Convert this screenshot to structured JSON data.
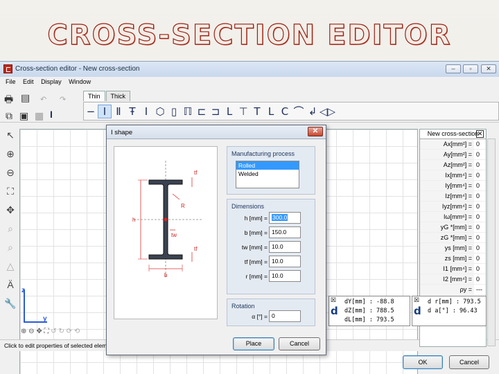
{
  "slide": {
    "title": "CROSS-SECTION EDITOR"
  },
  "window": {
    "title": "Cross-section editor - New cross-section",
    "controls": [
      "–",
      "▫",
      "✕"
    ]
  },
  "menu": [
    "File",
    "Edit",
    "Display",
    "Window"
  ],
  "tabs": [
    "Thin",
    "Thick"
  ],
  "status": "Click to edit properties of selected eleme",
  "axes": {
    "z": "z",
    "y": "y"
  },
  "properties": {
    "header": "New cross-section",
    "rows": [
      {
        "label": "Ax[mm²] =",
        "value": "0"
      },
      {
        "label": "Ay[mm²] =",
        "value": "0"
      },
      {
        "label": "Az[mm²] =",
        "value": "0"
      },
      {
        "label": "Ix[mm⁴] =",
        "value": "0"
      },
      {
        "label": "Iy[mm⁴] =",
        "value": "0"
      },
      {
        "label": "Iz[mm⁴] =",
        "value": "0"
      },
      {
        "label": "Iyz[mm⁴] =",
        "value": "0"
      },
      {
        "label": "Iω[mm⁶] =",
        "value": "0"
      },
      {
        "label": "yG *[mm] =",
        "value": "0"
      },
      {
        "label": "zG *[mm] =",
        "value": "0"
      },
      {
        "label": "ys [mm] =",
        "value": "0"
      },
      {
        "label": "zs [mm] =",
        "value": "0"
      },
      {
        "label": "I1 [mm⁴] =",
        "value": "0"
      },
      {
        "label": "I2 [mm⁴] =",
        "value": "0"
      }
    ],
    "partial_row": {
      "label": "ρy =",
      "value": "---"
    }
  },
  "info1": {
    "lines": [
      "dY[mm] : -88.8",
      "dZ[mm] : 788.5",
      "dL[mm] : 793.5"
    ]
  },
  "info2": {
    "lines": [
      "d r[mm] : 793.5",
      "d  a[°] : 96.43"
    ]
  },
  "footer": {
    "ok": "OK",
    "cancel": "Cancel"
  },
  "dialog": {
    "title": "I shape",
    "manufacturing": {
      "label": "Manufacturing process",
      "options": [
        "Rolled",
        "Welded"
      ],
      "selected": "Rolled"
    },
    "dimensions": {
      "label": "Dimensions",
      "fields": [
        {
          "label": "h [mm] =",
          "value": "300.0"
        },
        {
          "label": "b [mm] =",
          "value": "150.0"
        },
        {
          "label": "tw [mm] =",
          "value": "10.0"
        },
        {
          "label": "tf [mm] =",
          "value": "10.0"
        },
        {
          "label": "r [mm] =",
          "value": "10.0"
        }
      ]
    },
    "rotation": {
      "label": "Rotation",
      "field": {
        "label": "α [°] =",
        "value": "0"
      }
    },
    "preview_labels": {
      "tf_top": "tf",
      "r": "R",
      "h": "h",
      "tw": "tw",
      "tf_bottom": "tf",
      "b": "b"
    },
    "buttons": {
      "place": "Place",
      "cancel": "Cancel"
    }
  }
}
